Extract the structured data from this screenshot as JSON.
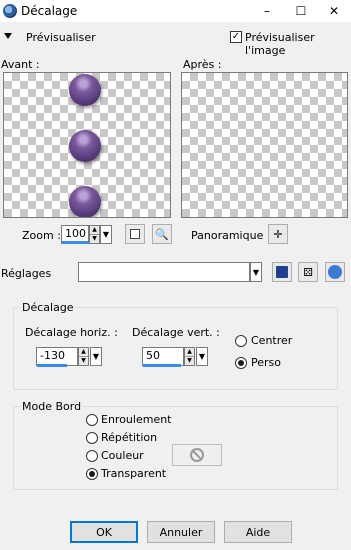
{
  "window": {
    "title": "Décalage",
    "minimize": "–",
    "maximize": "☐",
    "close": "✕"
  },
  "preview": {
    "toggle_label": "Prévisualiser",
    "checkbox_label": "Prévisualiser l'image",
    "checked": true
  },
  "panes": {
    "before_label": "Avant :",
    "after_label": "Après :"
  },
  "zoom": {
    "label": "Zoom :",
    "value": "100",
    "pan_label": "Panoramique :"
  },
  "presets": {
    "label": "Réglages",
    "value": ""
  },
  "offset": {
    "group_label": "Décalage",
    "horiz_label": "Décalage horiz. :",
    "horiz_value": "-130",
    "vert_label": "Décalage vert. :",
    "vert_value": "50",
    "center_label": "Centrer",
    "custom_label": "Perso",
    "selected": "custom"
  },
  "edge_mode": {
    "group_label": "Mode Bord",
    "options": [
      "Enroulement",
      "Répétition",
      "Couleur",
      "Transparent"
    ],
    "selected": "Transparent"
  },
  "buttons": {
    "ok": "OK",
    "cancel": "Annuler",
    "help": "Aide"
  },
  "colors": {
    "ball": "#6a4a8f",
    "accent": "#3b8ee8"
  }
}
